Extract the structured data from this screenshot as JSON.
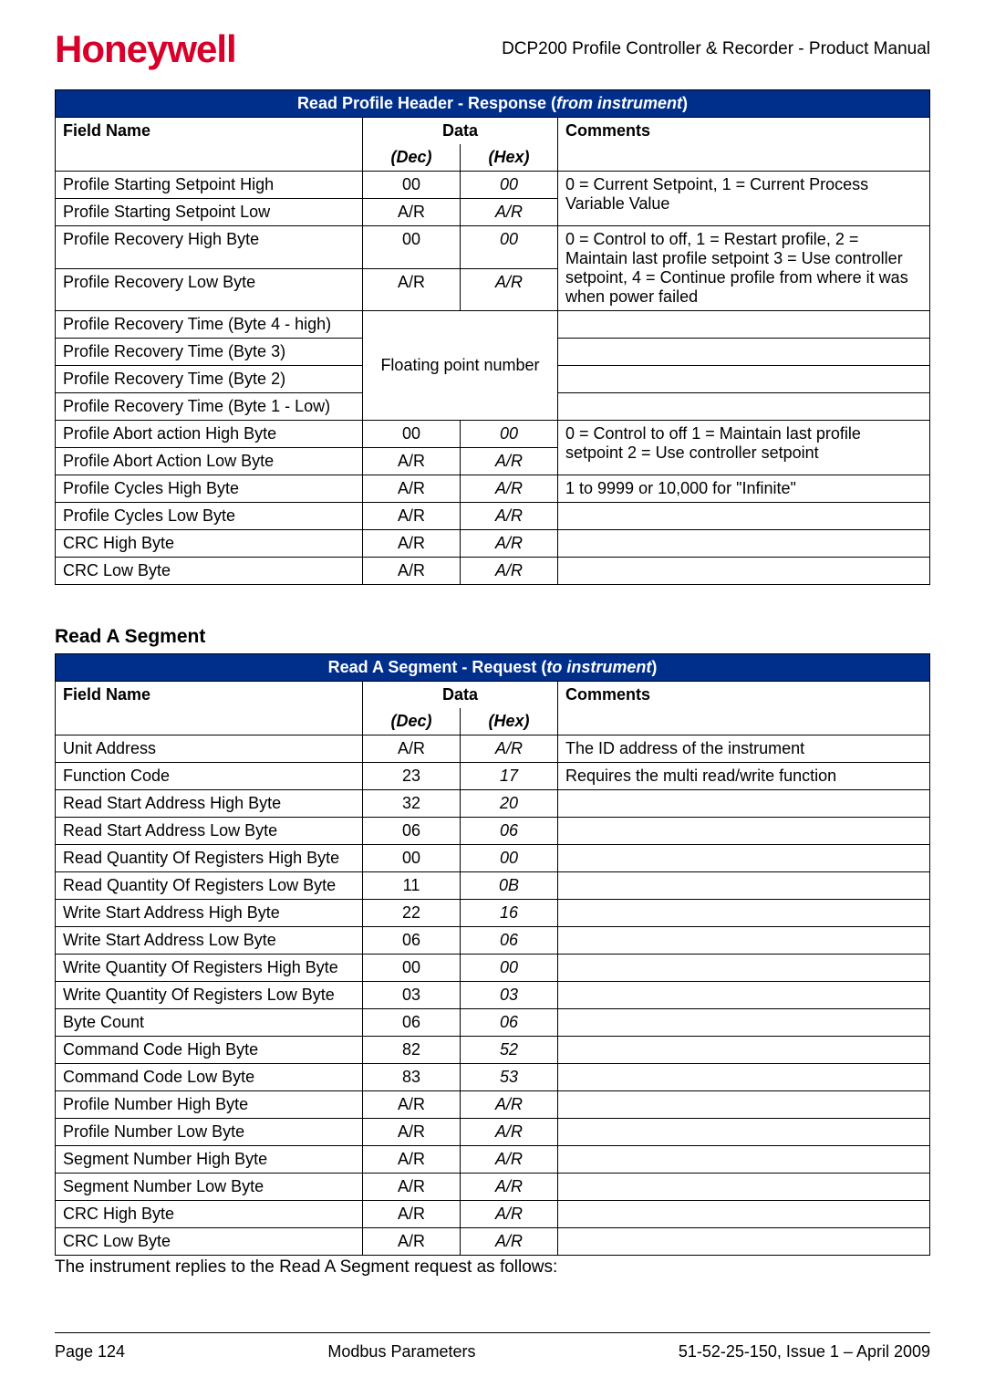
{
  "logo_text": "Honeywell",
  "doc_title": "DCP200 Profile Controller & Recorder - Product Manual",
  "table1": {
    "title_prefix": "Read Profile Header - Response (",
    "title_italic": "from instrument",
    "title_suffix": ")",
    "col_field": "Field Name",
    "col_data": "Data",
    "col_comments": "Comments",
    "col_dec": "(Dec)",
    "col_hex": "(Hex)",
    "floating": "Floating point number",
    "rows": [
      {
        "f": "Profile Starting Setpoint High",
        "d": "00",
        "h": "00"
      },
      {
        "f": "Profile Starting Setpoint Low",
        "d": "A/R",
        "h": "A/R"
      },
      {
        "f": "Profile Recovery High Byte",
        "d": "00",
        "h": "00"
      },
      {
        "f": "Profile Recovery Low Byte",
        "d": "A/R",
        "h": "A/R"
      },
      {
        "f": "Profile Recovery Time (Byte 4 - high)"
      },
      {
        "f": "Profile Recovery Time (Byte 3)"
      },
      {
        "f": "Profile Recovery Time (Byte 2)"
      },
      {
        "f": "Profile Recovery Time (Byte 1 - Low)"
      },
      {
        "f": "Profile Abort action High Byte",
        "d": "00",
        "h": "00"
      },
      {
        "f": "Profile Abort Action Low Byte",
        "d": "A/R",
        "h": "A/R"
      },
      {
        "f": "Profile Cycles High Byte",
        "d": "A/R",
        "h": "A/R"
      },
      {
        "f": "Profile Cycles Low Byte",
        "d": "A/R",
        "h": "A/R"
      },
      {
        "f": "CRC High Byte",
        "d": "A/R",
        "h": "A/R"
      },
      {
        "f": "CRC Low Byte",
        "d": "A/R",
        "h": "A/R"
      }
    ],
    "comment1": "0 = Current Setpoint, 1 = Current Process Variable Value",
    "comment2": "0 = Control to off, 1 = Restart profile, 2 = Maintain last profile setpoint 3 = Use controller setpoint, 4 = Continue profile from where it was when power failed",
    "comment3": "0 = Control to off 1 = Maintain last profile setpoint 2 = Use controller setpoint",
    "comment4": "1 to 9999 or 10,000 for \"Infinite\""
  },
  "section2_title": "Read A Segment",
  "table2": {
    "title_prefix": "Read A Segment - Request (",
    "title_italic": "to instrument",
    "title_suffix": ")",
    "col_field": "Field Name",
    "col_data": "Data",
    "col_comments": "Comments",
    "col_dec": "(Dec)",
    "col_hex": "(Hex)",
    "rows": [
      {
        "f": "Unit Address",
        "d": "A/R",
        "h": "A/R",
        "c": "The ID address of the instrument"
      },
      {
        "f": "Function Code",
        "d": "23",
        "h": "17",
        "c": "Requires the multi read/write function"
      },
      {
        "f": "Read Start Address High Byte",
        "d": "32",
        "h": "20",
        "c": ""
      },
      {
        "f": "Read Start Address Low Byte",
        "d": "06",
        "h": "06",
        "c": ""
      },
      {
        "f": "Read Quantity Of Registers High Byte",
        "d": "00",
        "h": "00",
        "c": ""
      },
      {
        "f": "Read Quantity Of Registers Low Byte",
        "d": "11",
        "h": "0B",
        "c": ""
      },
      {
        "f": "Write Start Address High Byte",
        "d": "22",
        "h": "16",
        "c": ""
      },
      {
        "f": "Write Start Address Low Byte",
        "d": "06",
        "h": "06",
        "c": ""
      },
      {
        "f": "Write Quantity Of Registers High Byte",
        "d": "00",
        "h": "00",
        "c": ""
      },
      {
        "f": "Write Quantity Of Registers Low Byte",
        "d": "03",
        "h": "03",
        "c": ""
      },
      {
        "f": "Byte Count",
        "d": "06",
        "h": "06",
        "c": ""
      },
      {
        "f": "Command Code High Byte",
        "d": "82",
        "h": "52",
        "c": ""
      },
      {
        "f": "Command Code Low Byte",
        "d": "83",
        "h": "53",
        "c": ""
      },
      {
        "f": "Profile Number High Byte",
        "d": "A/R",
        "h": "A/R",
        "c": ""
      },
      {
        "f": "Profile Number Low Byte",
        "d": "A/R",
        "h": "A/R",
        "c": ""
      },
      {
        "f": "Segment Number High Byte",
        "d": "A/R",
        "h": "A/R",
        "c": ""
      },
      {
        "f": "Segment Number Low Byte",
        "d": "A/R",
        "h": "A/R",
        "c": ""
      },
      {
        "f": "CRC High Byte",
        "d": "A/R",
        "h": "A/R",
        "c": ""
      },
      {
        "f": "CRC Low Byte",
        "d": "A/R",
        "h": "A/R",
        "c": ""
      }
    ]
  },
  "after_note": "The instrument replies to the Read A Segment request as follows:",
  "footer": {
    "left": "Page 124",
    "center": "Modbus Parameters",
    "right": "51-52-25-150, Issue 1 – April 2009"
  }
}
